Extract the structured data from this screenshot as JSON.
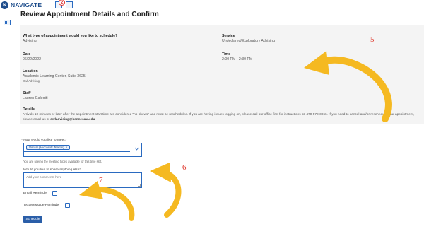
{
  "header": {
    "brand_logo": "N",
    "brand_name": "NAVIGATE",
    "notification_count": "2",
    "icons": [
      "navigate-logo-icon",
      "inbox-icon",
      "calendar-icon"
    ]
  },
  "sidebar": {
    "icons": [
      "appointments-icon"
    ]
  },
  "page": {
    "title": "Review Appointment Details and Confirm"
  },
  "details": {
    "type_label": "What type of appointment would you like to schedule?",
    "type_value": "Advising",
    "service_label": "Service",
    "service_value": "Undeclared/Exploratory Advising",
    "date_label": "Date",
    "date_value": "06/22/2022",
    "time_label": "Time",
    "time_value": "2:00 PM - 2:30 PM",
    "location_label": "Location",
    "location_value": "Academic Learning Center, Suite 3625",
    "location_sub": "Owl Advising",
    "staff_label": "Staff",
    "staff_value": "Lauren Galeotti",
    "details_label": "Details",
    "details_text": "Arrivals 10 minutes or later after the appointment start time are considered \"no-shows\" and must be rescheduled. If you are having issues logging on, please call our office first for instructions at: 470-578-3966. If you need to cancel and/or reschedule your appointment, please email us at ",
    "details_email": "owladvising@kennesaw.edu"
  },
  "form": {
    "meet_label": "* How would you like to meet?",
    "meet_chip": "Virtual (Microsoft Teams)",
    "meet_chip_remove": "×",
    "meet_help": "You are seeing the meeting types available for this time slot.",
    "share_label": "Would you like to share anything else?",
    "share_placeholder": "Add your comments here",
    "email_reminder_label": "Email Reminder",
    "text_reminder_label": "Text Message Reminder",
    "schedule_button": "Schedule"
  },
  "annotations": {
    "n5": "5",
    "n6": "6",
    "n7": "7"
  },
  "colors": {
    "accent": "#2a5ea8",
    "annotation_red": "#e03a2f",
    "arrow_yellow": "#f5b921",
    "card_bg": "#f4f4f4"
  }
}
